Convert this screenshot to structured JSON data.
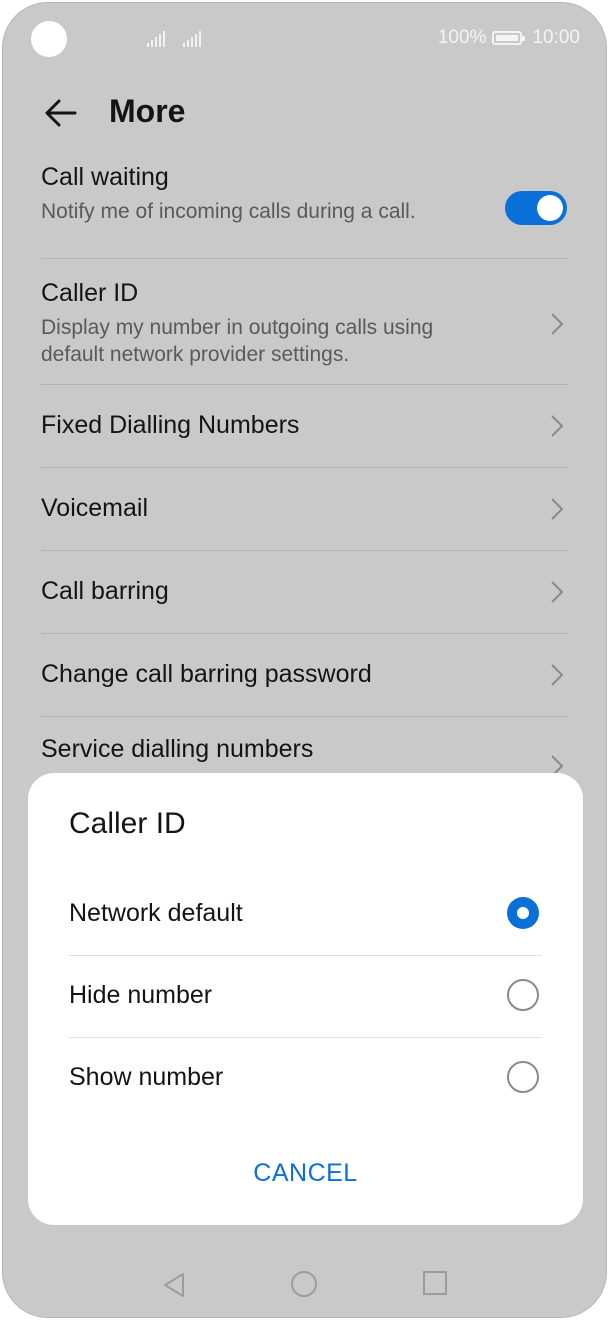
{
  "status_bar": {
    "battery": "100%",
    "time": "10:00"
  },
  "header": {
    "title": "More"
  },
  "settings": [
    {
      "label": "Call waiting",
      "subtitle": "Notify me of incoming calls during a call.",
      "toggle_on": true
    },
    {
      "label": "Caller ID",
      "subtitle": "Display my number in outgoing calls using default network provider settings."
    },
    {
      "label": "Fixed Dialling Numbers"
    },
    {
      "label": "Voicemail"
    },
    {
      "label": "Call barring"
    },
    {
      "label": "Change call barring password"
    },
    {
      "label": "Service dialling numbers"
    }
  ],
  "dialog": {
    "title": "Caller ID",
    "options": [
      {
        "label": "Network default",
        "selected": true
      },
      {
        "label": "Hide number",
        "selected": false
      },
      {
        "label": "Show number",
        "selected": false
      }
    ],
    "cancel": "CANCEL"
  },
  "colors": {
    "accent": "#0a6fd6",
    "scrim": "#c9c9c9"
  },
  "icons": [
    "back-arrow-icon",
    "chevron-right-icon",
    "nav-back-icon",
    "nav-home-icon",
    "nav-recent-icon"
  ]
}
